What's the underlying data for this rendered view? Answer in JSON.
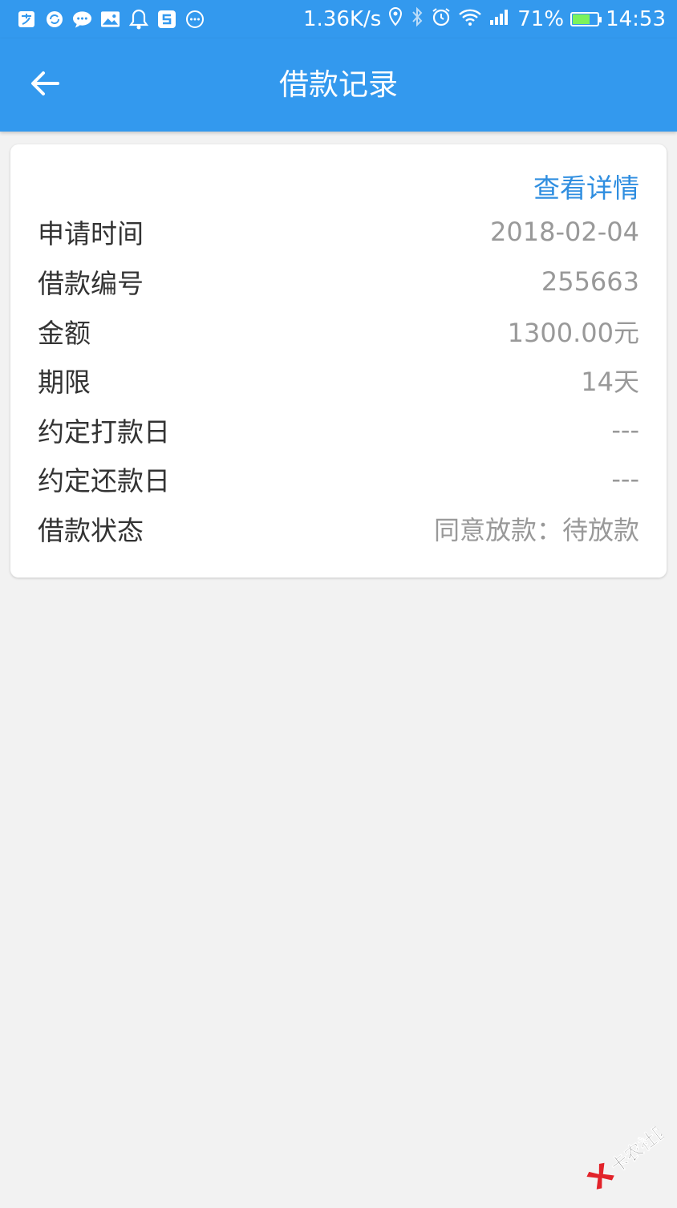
{
  "statusbar": {
    "network_speed": "1.36K/s",
    "battery_percent": "71%",
    "battery_level": 0.71,
    "time": "14:53",
    "left_icons": [
      "alipay-icon",
      "sync-icon",
      "chat-icon",
      "gallery-icon",
      "notification-icon",
      "s-app-icon",
      "more-icon"
    ],
    "right_icons": [
      "location-icon",
      "bluetooth-icon",
      "alarm-icon",
      "wifi-icon",
      "signal-icon"
    ]
  },
  "appbar": {
    "title": "借款记录",
    "back_icon": "arrow-left-icon"
  },
  "record": {
    "detail_link": "查看详情",
    "rows": [
      {
        "label": "申请时间",
        "value": "2018-02-04"
      },
      {
        "label": "借款编号",
        "value": "255663"
      },
      {
        "label": "金额",
        "value": "1300.00元"
      },
      {
        "label": "期限",
        "value": "14天"
      },
      {
        "label": "约定打款日",
        "value": "---"
      },
      {
        "label": "约定还款日",
        "value": "---"
      },
      {
        "label": "借款状态",
        "value": "同意放款：待放款"
      }
    ]
  },
  "watermark": {
    "text": "卡农社区"
  },
  "colors": {
    "primary": "#3399ee",
    "link": "#2f8ee0",
    "label": "#333333",
    "value": "#999999",
    "background": "#f2f2f2"
  }
}
